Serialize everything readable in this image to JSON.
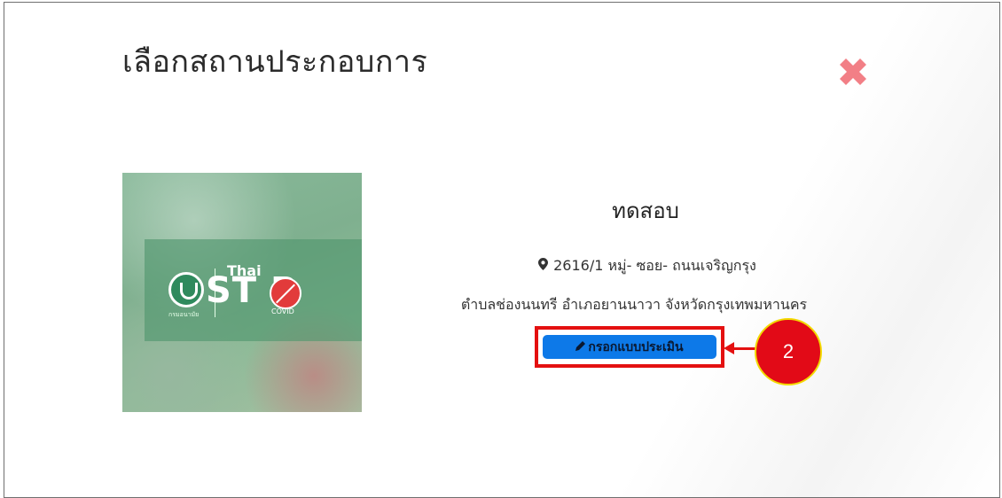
{
  "dialog": {
    "title": "เลือกสถานประกอบการ",
    "close_icon": "close-x-icon"
  },
  "card": {
    "image": {
      "logo_text": "กรมอนามัย",
      "thai_text": "Thai",
      "stop_text": "ST  P",
      "covid_text": "COVID"
    },
    "name": "ทดสอบ",
    "address_line1": "2616/1 หมู่- ซอย- ถนนเจริญกรุง",
    "address_line2": "ตำบลช่องนนทรี อำเภอยานนาวา จังหวัดกรุงเทพมหานคร",
    "pin_icon": "map-marker-icon",
    "evaluate_button": "กรอกแบบประเมิน",
    "pencil_icon": "pencil-icon"
  },
  "annotation": {
    "step_number": "2",
    "color": "#e41010",
    "badge_border": "#f3d900"
  },
  "colors": {
    "button": "#0d79e8",
    "close": "#f27f86"
  }
}
